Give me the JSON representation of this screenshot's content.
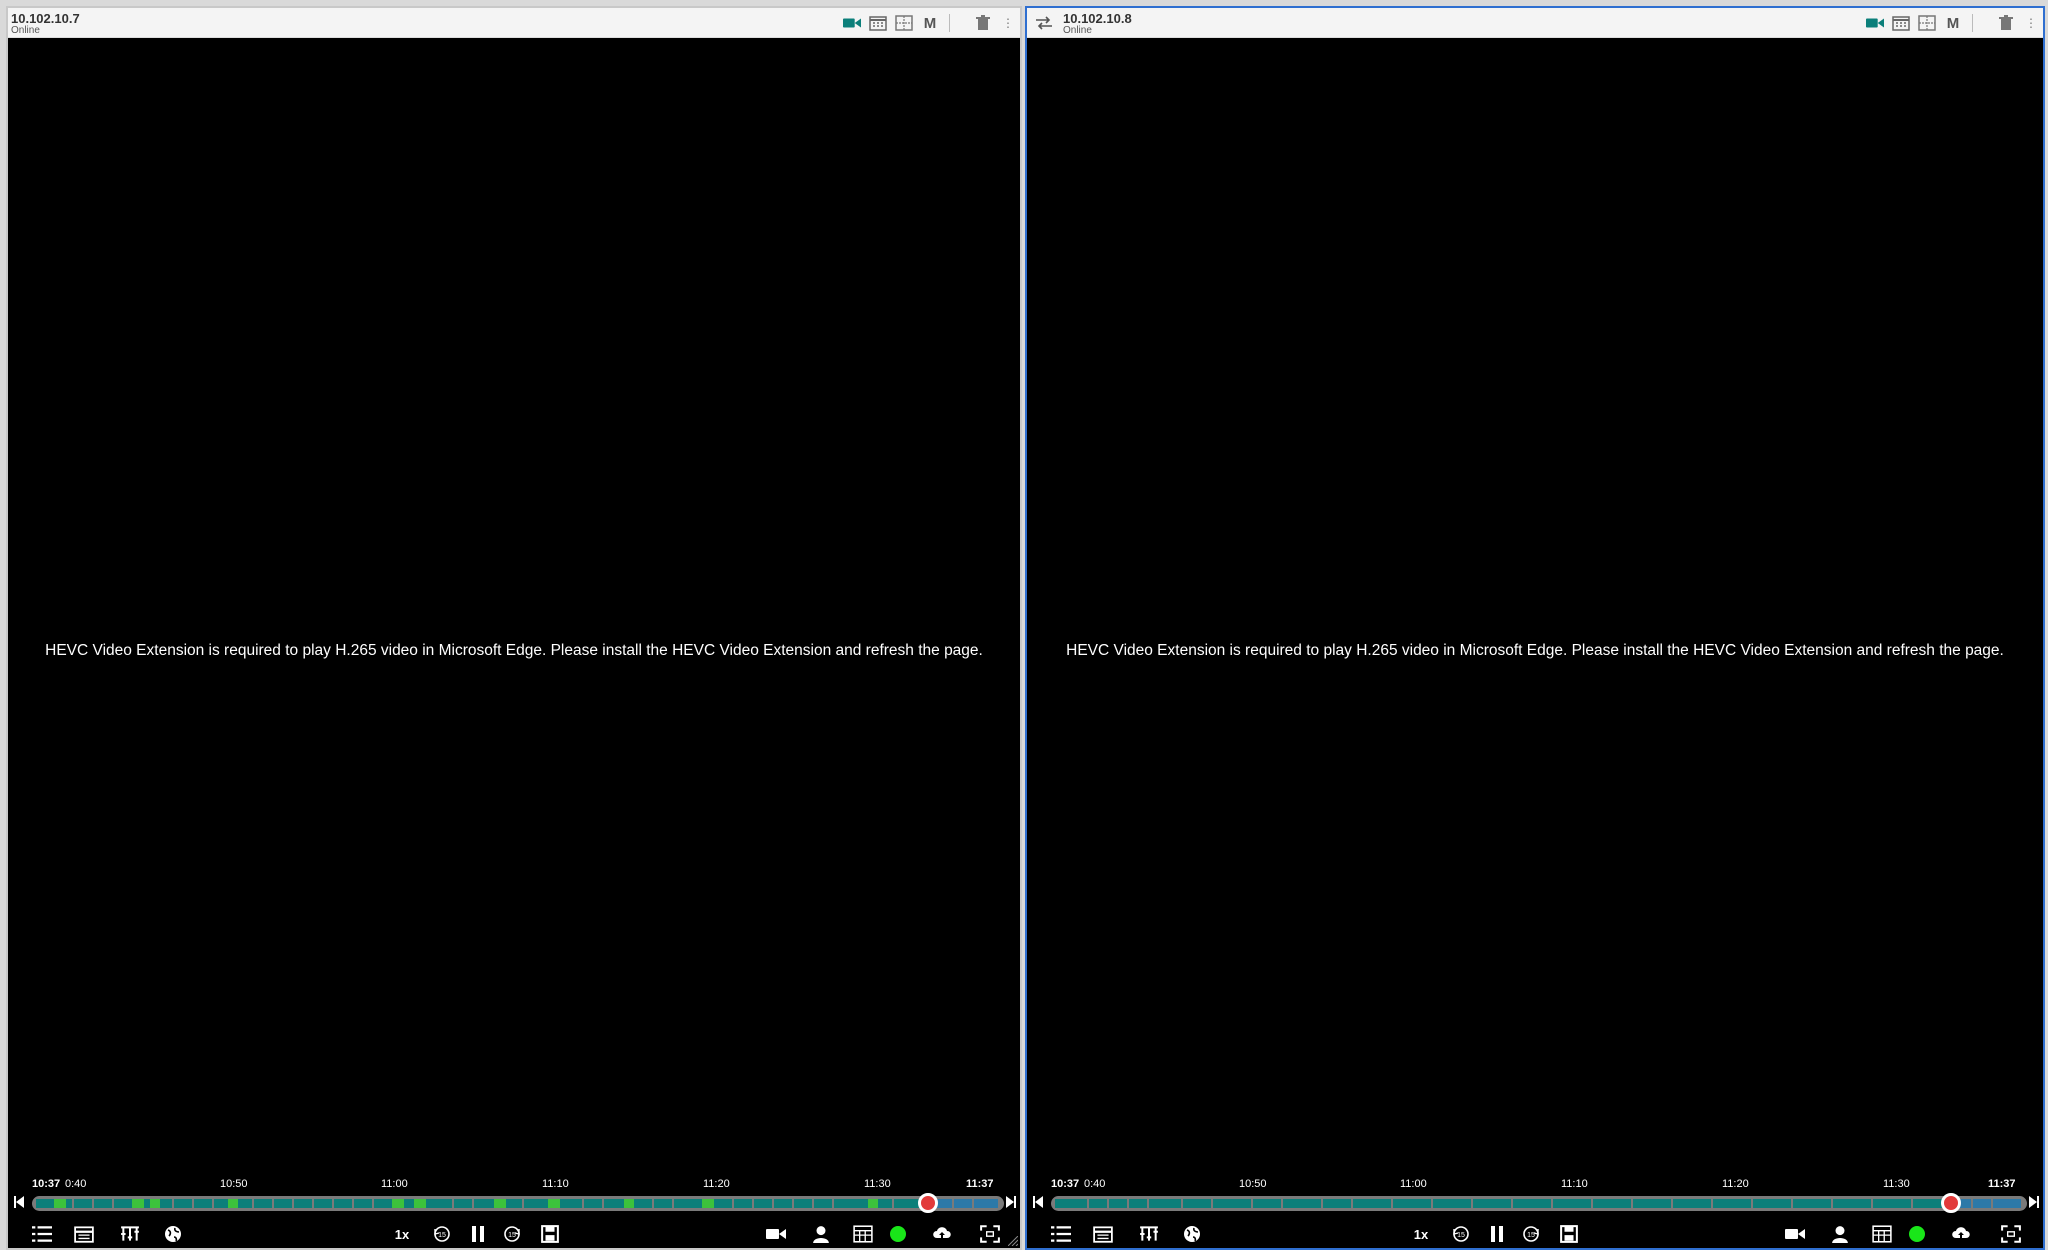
{
  "colors": {
    "accent_teal": "#0b7f7a",
    "motion_green": "#3cc23c",
    "active_border": "#2f6fd0",
    "status_online": "#19e619",
    "playhead": "#e23a3a"
  },
  "panels": [
    {
      "camera_name": "10.102.10.7",
      "status": "Online",
      "message": "HEVC Video Extension is required to play H.265 video in Microsoft Edge. Please install the HEVC Video Extension and refresh the page.",
      "timeline": {
        "start_label": "10:37",
        "first_tick": "0:40",
        "ticks": [
          "10:50",
          "11:00",
          "11:10",
          "11:20",
          "11:30"
        ],
        "end_label": "11:37",
        "playhead_fraction": 0.922
      },
      "speed": "1x"
    },
    {
      "camera_name": "10.102.10.8",
      "status": "Online",
      "message": "HEVC Video Extension is required to play H.265 video in Microsoft Edge. Please install the HEVC Video Extension and refresh the page.",
      "timeline": {
        "start_label": "10:37",
        "first_tick": "0:40",
        "ticks": [
          "10:50",
          "11:00",
          "11:10",
          "11:20",
          "11:30"
        ],
        "end_label": "11:37",
        "playhead_fraction": 0.922
      },
      "speed": "1x"
    }
  ],
  "header_icons": [
    "video-camera-icon",
    "calendar-icon",
    "layout-grid-icon",
    "motion-m-icon",
    "trash-icon",
    "kebab-menu-icon"
  ],
  "control_icons": [
    "list-icon",
    "calendar-icon",
    "filter-icon",
    "globe-icon",
    "replay-15-icon",
    "pause-icon",
    "forward-15-icon",
    "save-icon",
    "video-camera-icon",
    "person-icon",
    "grid-icon",
    "status-dot",
    "cloud-upload-icon",
    "fullscreen-icon"
  ]
}
